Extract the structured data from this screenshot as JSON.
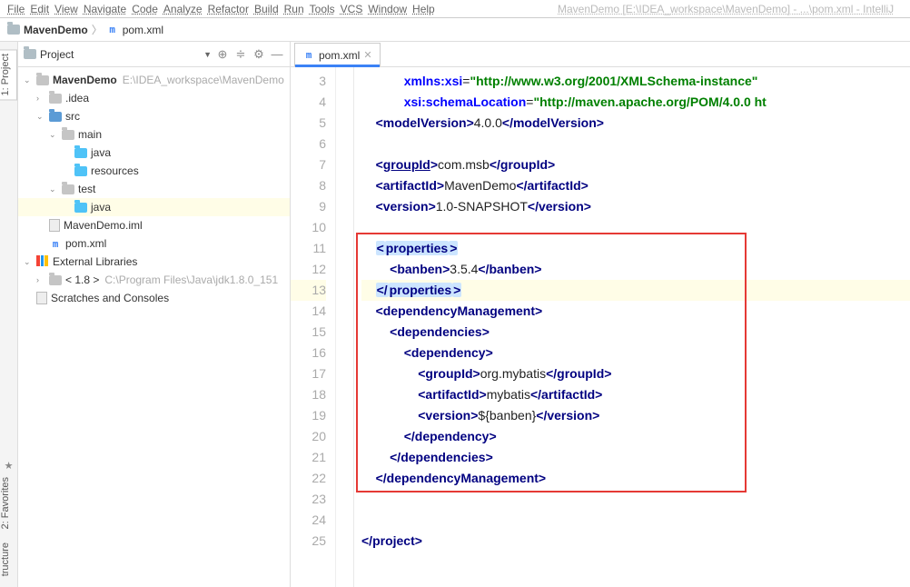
{
  "window_title": "MavenDemo [E:\\IDEA_workspace\\MavenDemo] - ...\\pom.xml - IntelliJ",
  "menu": [
    "File",
    "Edit",
    "View",
    "Navigate",
    "Code",
    "Analyze",
    "Refactor",
    "Build",
    "Run",
    "Tools",
    "VCS",
    "Window",
    "Help"
  ],
  "breadcrumb": {
    "project": "MavenDemo",
    "file": "pom.xml"
  },
  "project_panel": {
    "title": "Project",
    "toolbuttons": [
      "target",
      "sort",
      "gear",
      "hide"
    ],
    "tree": [
      {
        "ind": 0,
        "chev": "v",
        "icon": "dir-grey",
        "label": "MavenDemo",
        "path": "E:\\IDEA_workspace\\MavenDemo",
        "bold": true
      },
      {
        "ind": 1,
        "chev": ">",
        "icon": "dir-grey",
        "label": ".idea"
      },
      {
        "ind": 1,
        "chev": "v",
        "icon": "dir-blue",
        "label": "src"
      },
      {
        "ind": 2,
        "chev": "v",
        "icon": "dir-grey",
        "label": "main"
      },
      {
        "ind": 3,
        "chev": "",
        "icon": "dir-cyan",
        "label": "java"
      },
      {
        "ind": 3,
        "chev": "",
        "icon": "dir-cyan",
        "label": "resources"
      },
      {
        "ind": 2,
        "chev": "v",
        "icon": "dir-grey",
        "label": "test"
      },
      {
        "ind": 3,
        "chev": "",
        "icon": "dir-cyan",
        "label": "java",
        "sel": true
      },
      {
        "ind": 1,
        "chev": "",
        "icon": "file",
        "label": "MavenDemo.iml"
      },
      {
        "ind": 1,
        "chev": "",
        "icon": "m",
        "label": "pom.xml"
      },
      {
        "ind": 0,
        "chev": "v",
        "icon": "lib",
        "label": "External Libraries"
      },
      {
        "ind": 1,
        "chev": ">",
        "icon": "dir-grey",
        "label": "< 1.8 >",
        "path": "C:\\Program Files\\Java\\jdk1.8.0_151"
      },
      {
        "ind": 0,
        "chev": "",
        "icon": "file",
        "label": "Scratches and Consoles"
      }
    ]
  },
  "side_tabs": {
    "top": "1: Project",
    "bottom1": "2: Favorites",
    "bottom2": "tructure"
  },
  "editor_tab": "pom.xml",
  "line_start": 3,
  "highlighted_line": 13,
  "code_lines": [
    {
      "n": 3,
      "indent": "            ",
      "parts": [
        {
          "t": "attr",
          "s": "xmlns:xsi"
        },
        {
          "t": "txt",
          "s": "="
        },
        {
          "t": "str",
          "s": "\"http://www.w3.org/2001/XMLSchema-instance\""
        }
      ]
    },
    {
      "n": 4,
      "indent": "            ",
      "parts": [
        {
          "t": "attr",
          "s": "xsi:schemaLocation"
        },
        {
          "t": "txt",
          "s": "="
        },
        {
          "t": "str",
          "s": "\"http://maven.apache.org/POM/4.0.0 ht"
        }
      ]
    },
    {
      "n": 5,
      "indent": "    ",
      "parts": [
        {
          "t": "bracket",
          "s": "<"
        },
        {
          "t": "tag",
          "s": "modelVersion"
        },
        {
          "t": "bracket",
          "s": ">"
        },
        {
          "t": "txt",
          "s": "4.0.0"
        },
        {
          "t": "bracket",
          "s": "</"
        },
        {
          "t": "tag",
          "s": "modelVersion"
        },
        {
          "t": "bracket",
          "s": ">"
        }
      ]
    },
    {
      "n": 6,
      "indent": "",
      "parts": []
    },
    {
      "n": 7,
      "indent": "    ",
      "parts": [
        {
          "t": "bracket",
          "s": "<"
        },
        {
          "t": "tag-u",
          "s": "groupId"
        },
        {
          "t": "bracket",
          "s": ">"
        },
        {
          "t": "txt",
          "s": "com.msb"
        },
        {
          "t": "bracket",
          "s": "</"
        },
        {
          "t": "tag",
          "s": "groupId"
        },
        {
          "t": "bracket",
          "s": ">"
        }
      ]
    },
    {
      "n": 8,
      "indent": "    ",
      "parts": [
        {
          "t": "bracket",
          "s": "<"
        },
        {
          "t": "tag",
          "s": "artifactId"
        },
        {
          "t": "bracket",
          "s": ">"
        },
        {
          "t": "txt",
          "s": "MavenDemo"
        },
        {
          "t": "bracket",
          "s": "</"
        },
        {
          "t": "tag",
          "s": "artifactId"
        },
        {
          "t": "bracket",
          "s": ">"
        }
      ]
    },
    {
      "n": 9,
      "indent": "    ",
      "parts": [
        {
          "t": "bracket",
          "s": "<"
        },
        {
          "t": "tag",
          "s": "version"
        },
        {
          "t": "bracket",
          "s": ">"
        },
        {
          "t": "txt",
          "s": "1.0-SNAPSHOT"
        },
        {
          "t": "bracket",
          "s": "</"
        },
        {
          "t": "tag",
          "s": "version"
        },
        {
          "t": "bracket",
          "s": ">"
        }
      ]
    },
    {
      "n": 10,
      "indent": "",
      "parts": []
    },
    {
      "n": 11,
      "indent": "    ",
      "parts": [
        {
          "t": "bracket",
          "s": "<",
          "sel": true
        },
        {
          "t": "tag",
          "s": "properties",
          "sel": true
        },
        {
          "t": "bracket",
          "s": ">",
          "sel": true
        }
      ]
    },
    {
      "n": 12,
      "indent": "        ",
      "parts": [
        {
          "t": "bracket",
          "s": "<"
        },
        {
          "t": "tag",
          "s": "banben"
        },
        {
          "t": "bracket",
          "s": ">"
        },
        {
          "t": "txt",
          "s": "3.5.4"
        },
        {
          "t": "bracket",
          "s": "</"
        },
        {
          "t": "tag",
          "s": "banben"
        },
        {
          "t": "bracket",
          "s": ">"
        }
      ]
    },
    {
      "n": 13,
      "indent": "    ",
      "hl": true,
      "parts": [
        {
          "t": "bracket",
          "s": "</",
          "sel": true
        },
        {
          "t": "tag",
          "s": "properties",
          "sel": true
        },
        {
          "t": "bracket",
          "s": ">",
          "sel": true
        }
      ]
    },
    {
      "n": 14,
      "indent": "    ",
      "parts": [
        {
          "t": "bracket",
          "s": "<"
        },
        {
          "t": "tag",
          "s": "dependencyManagement"
        },
        {
          "t": "bracket",
          "s": ">"
        }
      ]
    },
    {
      "n": 15,
      "indent": "        ",
      "parts": [
        {
          "t": "bracket",
          "s": "<"
        },
        {
          "t": "tag",
          "s": "dependencies"
        },
        {
          "t": "bracket",
          "s": ">"
        }
      ]
    },
    {
      "n": 16,
      "indent": "            ",
      "parts": [
        {
          "t": "bracket",
          "s": "<"
        },
        {
          "t": "tag",
          "s": "dependency"
        },
        {
          "t": "bracket",
          "s": ">"
        }
      ]
    },
    {
      "n": 17,
      "indent": "                ",
      "parts": [
        {
          "t": "bracket",
          "s": "<"
        },
        {
          "t": "tag",
          "s": "groupId"
        },
        {
          "t": "bracket",
          "s": ">"
        },
        {
          "t": "txt",
          "s": "org.mybatis"
        },
        {
          "t": "bracket",
          "s": "</"
        },
        {
          "t": "tag",
          "s": "groupId"
        },
        {
          "t": "bracket",
          "s": ">"
        }
      ]
    },
    {
      "n": 18,
      "indent": "                ",
      "parts": [
        {
          "t": "bracket",
          "s": "<"
        },
        {
          "t": "tag",
          "s": "artifactId"
        },
        {
          "t": "bracket",
          "s": ">"
        },
        {
          "t": "txt",
          "s": "mybatis"
        },
        {
          "t": "bracket",
          "s": "</"
        },
        {
          "t": "tag",
          "s": "artifactId"
        },
        {
          "t": "bracket",
          "s": ">"
        }
      ]
    },
    {
      "n": 19,
      "indent": "                ",
      "parts": [
        {
          "t": "bracket",
          "s": "<"
        },
        {
          "t": "tag",
          "s": "version"
        },
        {
          "t": "bracket",
          "s": ">"
        },
        {
          "t": "txt",
          "s": "${banben}"
        },
        {
          "t": "bracket",
          "s": "</"
        },
        {
          "t": "tag",
          "s": "version"
        },
        {
          "t": "bracket",
          "s": ">"
        }
      ]
    },
    {
      "n": 20,
      "indent": "            ",
      "parts": [
        {
          "t": "bracket",
          "s": "</"
        },
        {
          "t": "tag",
          "s": "dependency"
        },
        {
          "t": "bracket",
          "s": ">"
        }
      ]
    },
    {
      "n": 21,
      "indent": "        ",
      "parts": [
        {
          "t": "bracket",
          "s": "</"
        },
        {
          "t": "tag",
          "s": "dependencies"
        },
        {
          "t": "bracket",
          "s": ">"
        }
      ]
    },
    {
      "n": 22,
      "indent": "    ",
      "parts": [
        {
          "t": "bracket",
          "s": "</"
        },
        {
          "t": "tag",
          "s": "dependencyManagement"
        },
        {
          "t": "bracket",
          "s": ">"
        }
      ]
    },
    {
      "n": 23,
      "indent": "",
      "parts": []
    },
    {
      "n": 24,
      "indent": "",
      "parts": []
    },
    {
      "n": 25,
      "indent": "",
      "parts": [
        {
          "t": "bracket",
          "s": "</"
        },
        {
          "t": "tag",
          "s": "project"
        },
        {
          "t": "bracket",
          "s": ">"
        }
      ]
    }
  ],
  "redbox": {
    "top_line": 11,
    "bottom_line": 22
  }
}
